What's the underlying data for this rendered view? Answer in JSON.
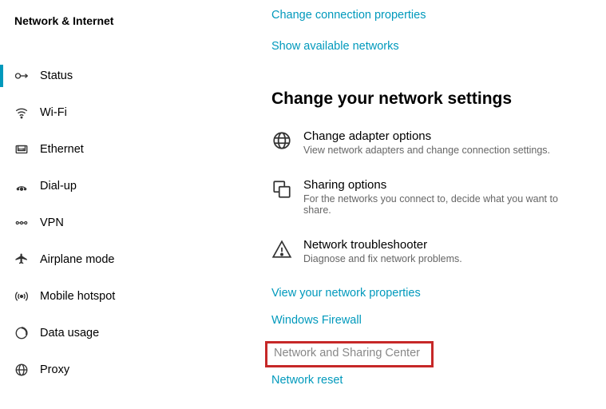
{
  "sidebar": {
    "title": "Network & Internet",
    "items": [
      {
        "label": "Status"
      },
      {
        "label": "Wi-Fi"
      },
      {
        "label": "Ethernet"
      },
      {
        "label": "Dial-up"
      },
      {
        "label": "VPN"
      },
      {
        "label": "Airplane mode"
      },
      {
        "label": "Mobile hotspot"
      },
      {
        "label": "Data usage"
      },
      {
        "label": "Proxy"
      }
    ]
  },
  "main": {
    "top_links": [
      "Change connection properties",
      "Show available networks"
    ],
    "section_title": "Change your network settings",
    "options": [
      {
        "title": "Change adapter options",
        "desc": "View network adapters and change connection settings."
      },
      {
        "title": "Sharing options",
        "desc": "For the networks you connect to, decide what you want to share."
      },
      {
        "title": "Network troubleshooter",
        "desc": "Diagnose and fix network problems."
      }
    ],
    "bottom_links": {
      "properties": "View your network properties",
      "firewall": "Windows Firewall",
      "sharing_center": "Network and Sharing Center",
      "reset": "Network reset"
    }
  }
}
